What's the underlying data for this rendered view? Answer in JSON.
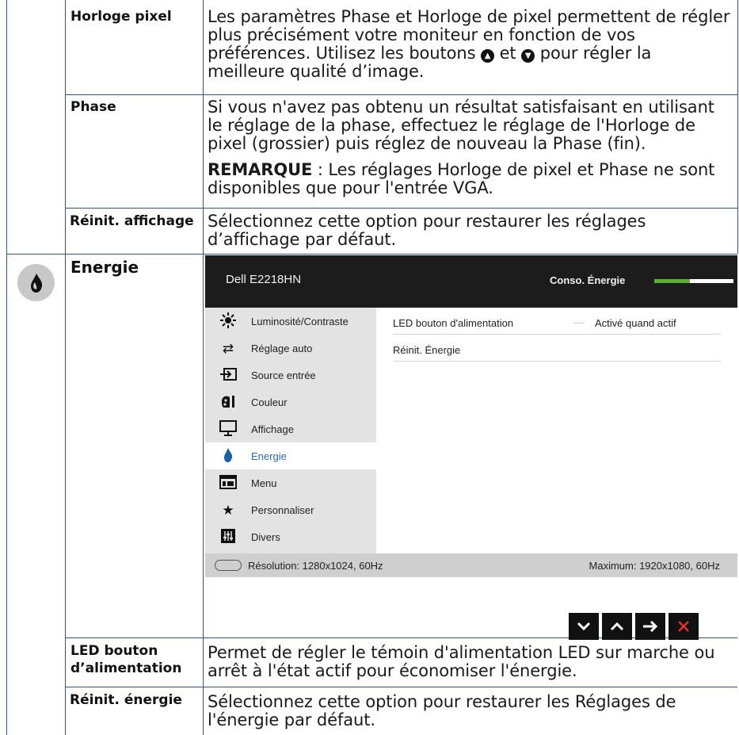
{
  "rows": [
    {
      "label": "Horloge pixel",
      "desc_part1": "Les paramètres Phase et Horloge de pixel permettent de régler plus précisément votre moniteur en fonction de vos préférences. Utilisez les boutons",
      "desc_and": "et",
      "desc_part2": "pour régler la meilleure qualité d’image."
    },
    {
      "label": "Phase",
      "desc": "Si vous n'avez pas obtenu un résultat satisfaisant en utilisant le réglage de la phase, effectuez le réglage de l'Horloge de pixel (grossier) puis réglez de nouveau la Phase (fin).",
      "note_label": "REMARQUE",
      "note_text": " : Les réglages Horloge de pixel et Phase ne sont disponibles que pour l'entrée VGA."
    },
    {
      "label": "Réinit. affichage",
      "desc": "Sélectionnez cette option pour restaurer les réglages d’affichage par défaut."
    },
    {
      "label": "Energie"
    },
    {
      "label_line1": "LED bouton",
      "label_line2": "d’alimentation",
      "desc": "Permet de régler le témoin d'alimentation LED sur marche ou arrêt à l'état actif pour économiser l'énergie."
    },
    {
      "label": "Réinit. énergie",
      "desc": "Sélectionnez cette option pour restaurer les Réglages de l'énergie par défaut."
    }
  ],
  "osd": {
    "model": "Dell E2218HN",
    "current_label": "Conso. Énergie",
    "energy_level_fraction": 0.45,
    "menu_items": [
      {
        "label": "Luminosité/Contraste",
        "icon": "brightness-icon"
      },
      {
        "label": "Réglage auto",
        "icon": "auto-adjust-icon"
      },
      {
        "label": "Source entrée",
        "icon": "input-source-icon"
      },
      {
        "label": "Couleur",
        "icon": "color-icon"
      },
      {
        "label": "Affichage",
        "icon": "display-icon"
      },
      {
        "label": "Energie",
        "icon": "energy-icon"
      },
      {
        "label": "Menu",
        "icon": "menu-icon"
      },
      {
        "label": "Personnaliser",
        "icon": "star-icon"
      },
      {
        "label": "Divers",
        "icon": "others-icon"
      }
    ],
    "active_index": 5,
    "panel_rows": [
      {
        "key": "LED bouton d'alimentation",
        "value": "Activé quand actif"
      },
      {
        "key": "Réinit. Énergie",
        "value": ""
      }
    ],
    "resolution": "Résolution: 1280x1024, 60Hz",
    "maximum": "Maximum: 1920x1080, 60Hz",
    "nav_buttons": [
      "down-arrow-icon",
      "up-arrow-icon",
      "right-arrow-icon",
      "close-icon"
    ]
  },
  "colors": {
    "grid_line": "#2a5a8a",
    "osd_header": "#1c1c1c",
    "energy_bar": "#5ab030",
    "active_menu_text": "#2a6ab8",
    "close_red": "#e23030"
  }
}
